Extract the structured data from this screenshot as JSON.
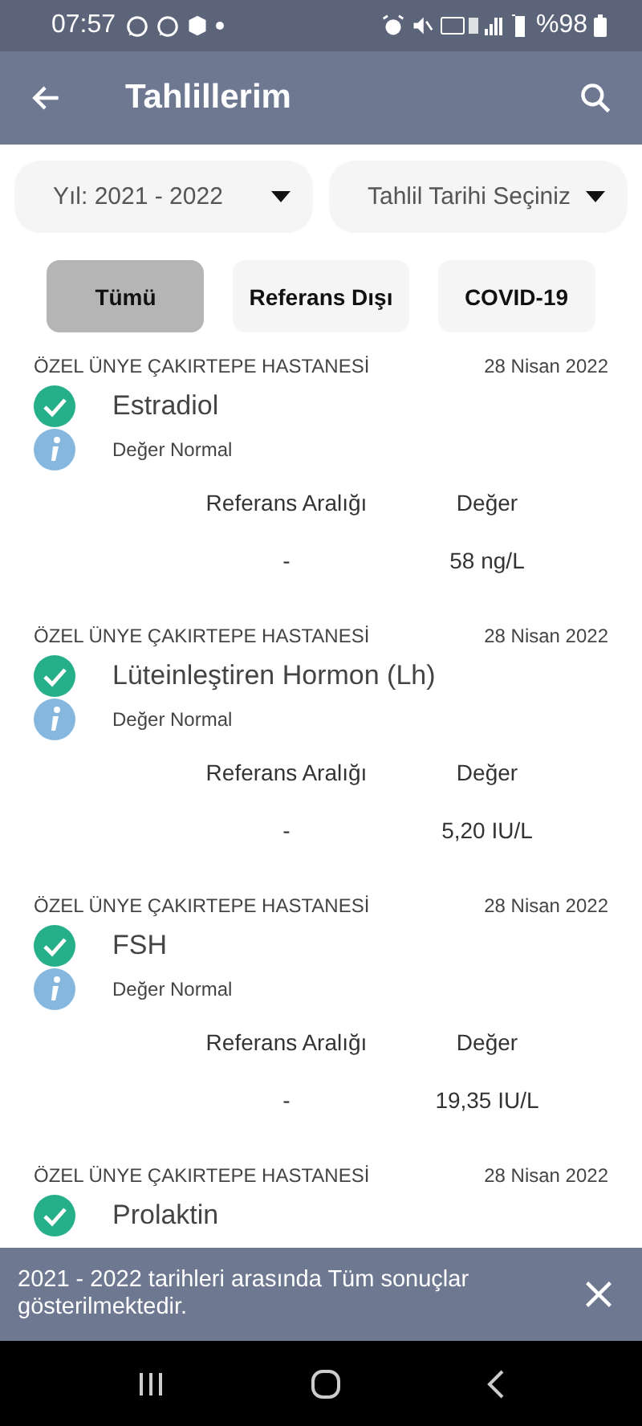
{
  "status_bar": {
    "time": "07:57",
    "battery": "%98"
  },
  "app_bar": {
    "title": "Tahlillerim"
  },
  "filters": [
    {
      "label": "Yıl: 2021 - 2022"
    },
    {
      "label": "Tahlil Tarihi Seçiniz"
    }
  ],
  "chips": [
    {
      "label": "Tümü",
      "selected": true
    },
    {
      "label": "Referans Dışı",
      "selected": false
    },
    {
      "label": "COVID-19",
      "selected": false
    }
  ],
  "results": [
    {
      "hospital": "ÖZEL ÜNYE ÇAKIRTEPE HASTANESİ",
      "date": "28 Nisan 2022",
      "name": "Estradiol",
      "normal": true,
      "status": "Değer Normal",
      "range_label": "Referans Aralığı",
      "value_label": "Değer",
      "range": "-",
      "value": "58 ng/L"
    },
    {
      "hospital": "ÖZEL ÜNYE ÇAKIRTEPE HASTANESİ",
      "date": "28 Nisan 2022",
      "name": "Lüteinleştiren Hormon (Lh)",
      "normal": true,
      "status": "Değer Normal",
      "range_label": "Referans Aralığı",
      "value_label": "Değer",
      "range": "-",
      "value": "5,20 IU/L"
    },
    {
      "hospital": "ÖZEL ÜNYE ÇAKIRTEPE HASTANESİ",
      "date": "28 Nisan 2022",
      "name": "FSH",
      "normal": true,
      "status": "Değer Normal",
      "range_label": "Referans Aralığı",
      "value_label": "Değer",
      "range": "-",
      "value": "19,35 IU/L"
    },
    {
      "hospital": "ÖZEL ÜNYE ÇAKIRTEPE HASTANESİ",
      "date": "28 Nisan 2022",
      "name": "Prolaktin",
      "normal": true
    }
  ],
  "snackbar": {
    "message": "2021 - 2022 tarihleri arasında Tüm sonuçlar gösterilmektedir."
  }
}
